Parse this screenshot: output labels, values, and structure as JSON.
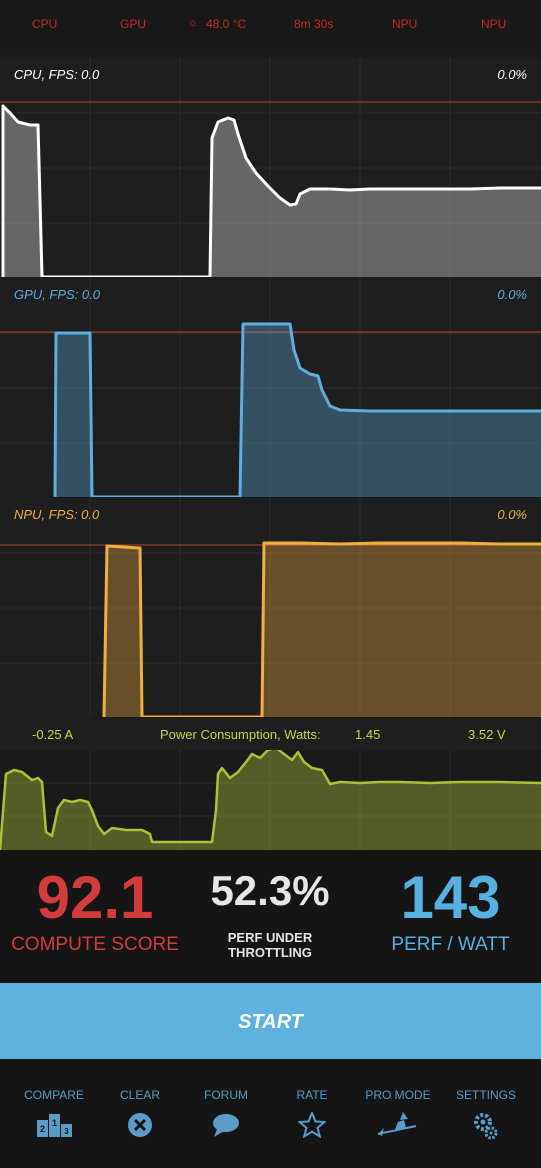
{
  "status_bar": {
    "cpu": "CPU",
    "gpu": "GPU",
    "temp": "48.0 °C",
    "time": "8m 30s",
    "npu1": "NPU",
    "npu2": "NPU"
  },
  "panels": {
    "cpu": {
      "label": "CPU, FPS:  0.0",
      "value": "0.0%",
      "color": "#ffffff"
    },
    "gpu": {
      "label": "GPU, FPS:  0.0",
      "value": "0.0%",
      "color": "#5eaee0"
    },
    "npu": {
      "label": "NPU, FPS:  0.0",
      "value": "0.0%",
      "color": "#f0b040"
    }
  },
  "power": {
    "current": "-0.25 A",
    "label": "Power Consumption, Watts:",
    "watts": "1.45",
    "voltage": "3.52 V",
    "color": "#a9c23a"
  },
  "scores": {
    "compute": {
      "value": "92.1",
      "label": "COMPUTE SCORE",
      "color": "#d23c3c"
    },
    "throttle": {
      "value": "52.3%",
      "label_line1": "PERF UNDER",
      "label_line2": "THROTTLING",
      "color": "#e6e6e6"
    },
    "perf_watt": {
      "value": "143",
      "label": "PERF / WATT",
      "color": "#56b1e0"
    }
  },
  "start_button": {
    "label": "START"
  },
  "nav": [
    {
      "label": "COMPARE",
      "icon": "podium-icon"
    },
    {
      "label": "CLEAR",
      "icon": "clear-icon"
    },
    {
      "label": "FORUM",
      "icon": "chat-bubble-icon"
    },
    {
      "label": "RATE",
      "icon": "star-icon"
    },
    {
      "label": "PRO MODE",
      "icon": "witch-icon"
    },
    {
      "label": "SETTINGS",
      "icon": "gear-icon"
    }
  ],
  "podium_digits": {
    "first": "1",
    "second": "2",
    "third": "3"
  }
}
